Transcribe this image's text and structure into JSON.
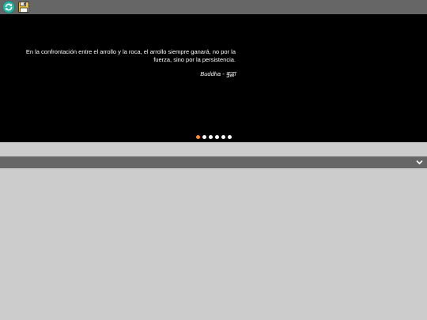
{
  "toolbar": {
    "refresh_icon": "refresh-icon",
    "save_icon": "floppy-disk-icon"
  },
  "quote": {
    "text": "En la confrontación entre el arrollo y la roca, el arrollo siempre ganará, no por la fuerza, sino por la persistencia.",
    "author": "Buddha - बुद्धा"
  },
  "carousel": {
    "slide_count": 6,
    "active_index": 0
  },
  "collapse_bar": {
    "icon": "chevron-down-icon"
  },
  "colors": {
    "toolbar_bg": "#666666",
    "quote_bg": "#000000",
    "page_bg": "#cccccc",
    "active_dot": "#ff8c2e",
    "inactive_dot": "#ffffff"
  }
}
